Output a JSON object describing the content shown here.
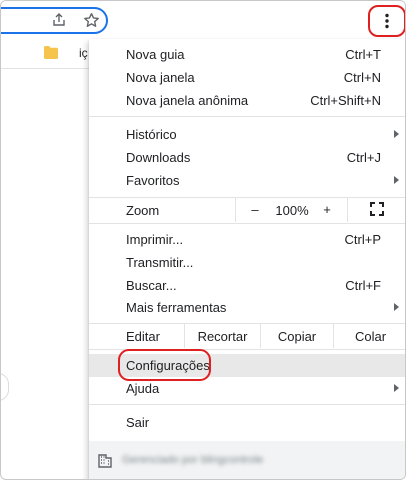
{
  "bookmarks": {
    "item_label": "iç"
  },
  "menu": {
    "new_tab": {
      "label": "Nova guia",
      "shortcut": "Ctrl+T"
    },
    "new_window": {
      "label": "Nova janela",
      "shortcut": "Ctrl+N"
    },
    "incognito": {
      "label": "Nova janela anônima",
      "shortcut": "Ctrl+Shift+N"
    },
    "history": {
      "label": "Histórico"
    },
    "downloads": {
      "label": "Downloads",
      "shortcut": "Ctrl+J"
    },
    "bookmarks": {
      "label": "Favoritos"
    },
    "zoom": {
      "label": "Zoom",
      "minus": "–",
      "value": "100%",
      "plus": "+"
    },
    "print": {
      "label": "Imprimir...",
      "shortcut": "Ctrl+P"
    },
    "cast": {
      "label": "Transmitir..."
    },
    "find": {
      "label": "Buscar...",
      "shortcut": "Ctrl+F"
    },
    "more_tools": {
      "label": "Mais ferramentas"
    },
    "edit": {
      "label": "Editar",
      "cut": "Recortar",
      "copy": "Copiar",
      "paste": "Colar"
    },
    "settings": {
      "label": "Configurações"
    },
    "help": {
      "label": "Ajuda"
    },
    "exit": {
      "label": "Sair"
    },
    "managed": {
      "label": "Gerenciado por blingcontrole"
    }
  },
  "colors": {
    "accent": "#1a73e8",
    "annotation": "#e0201f",
    "hover": "#e8e8e8"
  }
}
